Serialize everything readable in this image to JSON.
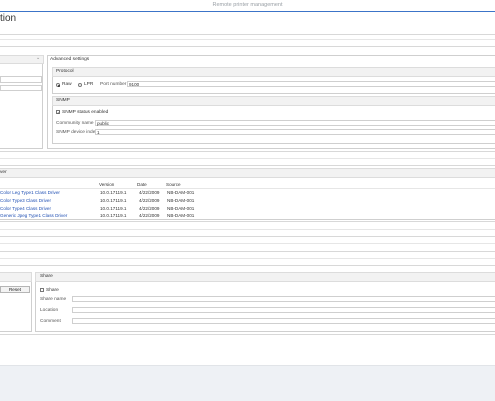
{
  "window": {
    "title": "Remote printer management"
  },
  "page": {
    "title_fragment": "tion"
  },
  "advanced": {
    "title": "Advanced settings",
    "protocol": {
      "title": "Protocol",
      "raw_label": "Raw",
      "lpr_label": "LPR",
      "selected": "Raw",
      "port_label": "Port number",
      "port_value": "9100"
    },
    "snmp": {
      "title": "SNMP",
      "status_label": "SNMP status enabled",
      "status_checked": true,
      "community_label": "Community name",
      "community_value": "public",
      "index_label": "SNMP device index",
      "index_value": "1"
    }
  },
  "drivers": {
    "section_fragment": "ver",
    "headers": {
      "version": "Version",
      "date": "Date",
      "source": "Source"
    },
    "rows": [
      {
        "name": "Color Leg Type1 Class Driver",
        "version": "10.0.17119.1",
        "date": "4/22/2009",
        "source": "NB-DAM-001"
      },
      {
        "name": "Color Type3 Class Driver",
        "version": "10.0.17119.1",
        "date": "4/22/2009",
        "source": "NB-DAM-001"
      },
      {
        "name": "Color Type4 Class Driver",
        "version": "10.0.17119.1",
        "date": "4/22/2009",
        "source": "NB-DAM-001"
      },
      {
        "name": "Generic Jpeg Type1 Class Driver",
        "version": "10.0.17119.1",
        "date": "4/22/2009",
        "source": "NB-DAM-001"
      }
    ]
  },
  "reset": {
    "label": "Reset"
  },
  "share": {
    "title": "Share",
    "checkbox_label": "Share",
    "checked": false,
    "share_name_label": "Share name",
    "share_name_value": "",
    "location_label": "Location",
    "location_value": "",
    "comment_label": "Comment",
    "comment_value": ""
  }
}
